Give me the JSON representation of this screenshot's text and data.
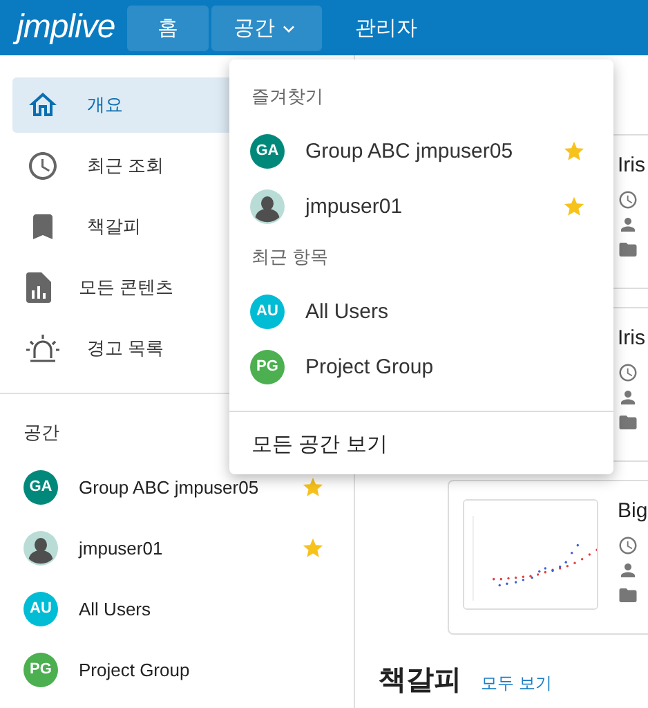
{
  "header": {
    "logo": "jmplive",
    "nav": [
      {
        "label": "홈",
        "selected": true,
        "kind": "link"
      },
      {
        "label": "공간",
        "selected": true,
        "expanded": true,
        "kind": "menu"
      },
      {
        "label": "관리자",
        "selected": false,
        "kind": "link"
      }
    ]
  },
  "sidebar": {
    "nav": [
      {
        "label": "개요",
        "selected": true
      },
      {
        "label": "최근 조회",
        "selected": false
      },
      {
        "label": "책갈피",
        "selected": false
      },
      {
        "label": "모든 콘텐츠",
        "selected": false
      },
      {
        "label": "경고 목록",
        "selected": false
      }
    ],
    "spaces_heading": "공간",
    "spaces": [
      {
        "kind": "initials",
        "initials": "GA",
        "color": "#00897b",
        "name": "Group ABC jmpuser05",
        "favorite": true
      },
      {
        "kind": "photo",
        "name": "jmpuser01",
        "favorite": true
      },
      {
        "kind": "initials",
        "initials": "AU",
        "color": "#00bcd4",
        "name": "All Users",
        "favorite": false
      },
      {
        "kind": "initials",
        "initials": "PG",
        "color": "#4caf50",
        "name": "Project Group",
        "favorite": false
      }
    ]
  },
  "spaces_menu": {
    "sections": [
      {
        "heading": "즐겨찾기",
        "items": [
          {
            "kind": "initials",
            "initials": "GA",
            "color": "#00897b",
            "name": "Group ABC jmpuser05",
            "favorite": true
          },
          {
            "kind": "photo",
            "name": "jmpuser01",
            "favorite": true
          }
        ]
      },
      {
        "heading": "최근 항목",
        "items": [
          {
            "kind": "initials",
            "initials": "AU",
            "color": "#00bcd4",
            "name": "All Users",
            "favorite": false
          },
          {
            "kind": "initials",
            "initials": "PG",
            "color": "#4caf50",
            "name": "Project Group",
            "favorite": false
          }
        ]
      }
    ],
    "footer_link": "모든 공간 보기"
  },
  "content": {
    "cards": [
      {
        "title": "Iris"
      },
      {
        "title": "Iris"
      },
      {
        "title": "Big",
        "thumbnail": true
      }
    ],
    "bookmarks_heading": "책갈피",
    "view_all_link": "모두 보기"
  }
}
